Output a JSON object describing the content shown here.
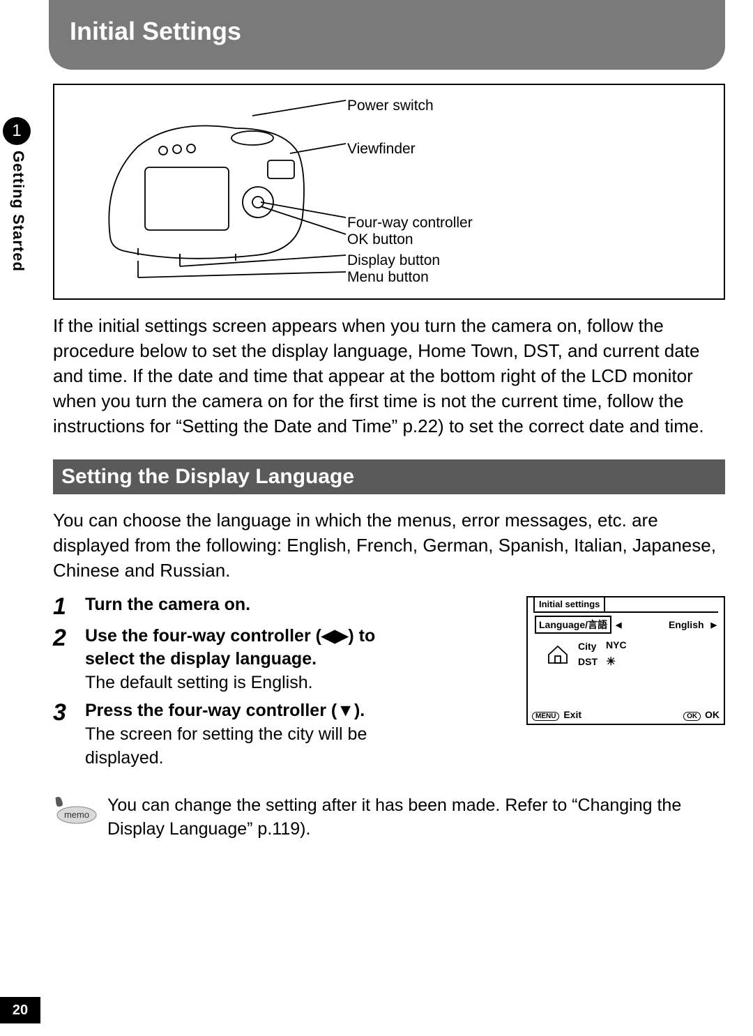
{
  "header": {
    "title": "Initial Settings"
  },
  "gutter": {
    "chapter_num": "1",
    "chapter_label": "Getting Started",
    "page": "20"
  },
  "diagram": {
    "labels": {
      "power": "Power switch",
      "viewfinder": "Viewfinder",
      "fourway": "Four-way controller",
      "ok": "OK button",
      "display": "Display button",
      "menu": "Menu button"
    }
  },
  "intro": "If the initial settings screen appears when you turn the camera on, follow the procedure below to set the display language, Home Town, DST, and current date and time. If the date and time that appear at the bottom right of the LCD monitor when you turn the camera on for the first time is not the current time, follow the instructions for “Setting the Date and Time” p.22) to set the correct date and time.",
  "section": {
    "title": "Setting the Display Language",
    "lead": "You can choose the language in which the menus, error messages, etc. are displayed from the following: English, French, German, Spanish, Italian, Japanese, Chinese and Russian."
  },
  "steps": {
    "s1": {
      "num": "1",
      "title": "Turn the camera on."
    },
    "s2": {
      "num": "2",
      "title": "Use the four-way controller (◀▶) to select the display language.",
      "sub": "The default setting is English."
    },
    "s3": {
      "num": "3",
      "title": "Press the four-way controller (▼).",
      "sub": "The screen for setting the city will be displayed."
    }
  },
  "screen": {
    "tab": "Initial settings",
    "lang_label": "Language/言語",
    "lang_value": "English",
    "city_label": "City",
    "city_value": "NYC",
    "dst_label": "DST",
    "exit": "Exit",
    "ok": "OK",
    "menu_btn": "MENU",
    "ok_btn": "OK"
  },
  "memo": {
    "badge": "memo",
    "text": "You can change the setting after it has been made. Refer to “Changing the Display Language” p.119)."
  }
}
